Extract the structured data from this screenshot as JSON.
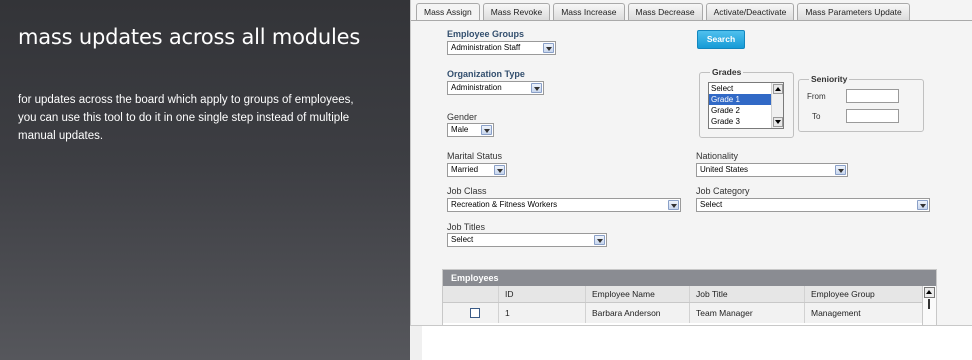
{
  "promo": {
    "title": "mass updates across all modules",
    "description": "for updates across the board which apply to groups of employees, you can use this tool to do it in one single step instead of multiple manual updates."
  },
  "tabs": [
    {
      "label": "Mass Assign",
      "active": true
    },
    {
      "label": "Mass Revoke",
      "active": false
    },
    {
      "label": "Mass Increase",
      "active": false
    },
    {
      "label": "Mass Decrease",
      "active": false
    },
    {
      "label": "Activate/Deactivate",
      "active": false
    },
    {
      "label": "Mass Parameters Update",
      "active": false
    }
  ],
  "form": {
    "employee_groups": {
      "label": "Employee Groups",
      "value": "Administration Staff"
    },
    "organization_type": {
      "label": "Organization Type",
      "value": "Administration"
    },
    "gender": {
      "label": "Gender",
      "value": "Male"
    },
    "marital_status": {
      "label": "Marital Status",
      "value": "Married"
    },
    "nationality": {
      "label": "Nationality",
      "value": "United States"
    },
    "job_class": {
      "label": "Job Class",
      "value": "Recreation & Fitness Workers"
    },
    "job_category": {
      "label": "Job Category",
      "value": "Select"
    },
    "job_titles": {
      "label": "Job Titles",
      "value": "Select"
    },
    "search_label": "Search",
    "grades": {
      "legend": "Grades",
      "options": [
        "Select",
        "Grade 1",
        "Grade 2",
        "Grade 3"
      ],
      "selected": "Grade 1"
    },
    "seniority": {
      "legend": "Seniority",
      "from_label": "From",
      "to_label": "To",
      "from_value": "",
      "to_value": ""
    }
  },
  "employees": {
    "title": "Employees",
    "columns": [
      "ID",
      "Employee Name",
      "Job Title",
      "Employee Group"
    ],
    "rows": [
      {
        "checked": false,
        "id": "1",
        "name": "Barbara Anderson",
        "job_title": "Team Manager",
        "group": "Management"
      }
    ]
  },
  "colors": {
    "promo_bg": "#3d3e43",
    "accent": "#1aa3dd",
    "label_blue": "#334f6e",
    "table_header": "#8a8c92"
  }
}
